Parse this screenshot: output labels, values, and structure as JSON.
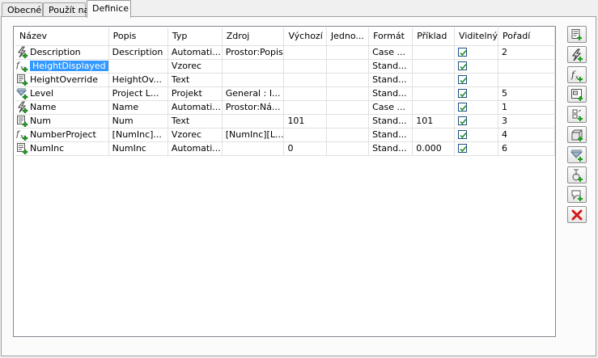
{
  "tabs": [
    {
      "label": "Obecné"
    },
    {
      "label": "Použít na"
    },
    {
      "label": "Definice"
    }
  ],
  "grid": {
    "columns": [
      "Název",
      "Popis",
      "Typ",
      "Zdroj",
      "Výchozí",
      "Jedno...",
      "Formát",
      "Příklad",
      "Viditelný",
      "Pořadí"
    ],
    "rows": [
      {
        "icon": "automatic-property-icon",
        "name": "Description",
        "popis": "Description",
        "typ": "Automati...",
        "zdroj": "Prostor:Popis",
        "vychozi": "",
        "jedno": "",
        "format": "Case ...",
        "priklad": "",
        "visible": true,
        "poradi": "2"
      },
      {
        "icon": "formula-property-icon",
        "name": "HeightDisplayed",
        "popis": "",
        "typ": "Vzorec",
        "zdroj": "",
        "vychozi": "",
        "jedno": "",
        "format": "Stand...",
        "priklad": "",
        "visible": true,
        "poradi": ""
      },
      {
        "icon": "text-property-icon",
        "name": "HeightOverride",
        "popis": "HeightOv...",
        "typ": "Text",
        "zdroj": "",
        "vychozi": "",
        "jedno": "",
        "format": "Stand...",
        "priklad": "",
        "visible": true,
        "poradi": ""
      },
      {
        "icon": "project-property-icon",
        "name": "Level",
        "popis": "Project L...",
        "typ": "Projekt",
        "zdroj": "General : I...",
        "vychozi": "",
        "jedno": "",
        "format": "Stand...",
        "priklad": "",
        "visible": true,
        "poradi": "5"
      },
      {
        "icon": "automatic-property-icon",
        "name": "Name",
        "popis": "Name",
        "typ": "Automati...",
        "zdroj": "Prostor:Ná...",
        "vychozi": "",
        "jedno": "",
        "format": "Case ...",
        "priklad": "",
        "visible": true,
        "poradi": "1"
      },
      {
        "icon": "text-property-icon",
        "name": "Num",
        "popis": "Num",
        "typ": "Text",
        "zdroj": "",
        "vychozi": "101",
        "jedno": "",
        "format": "Stand...",
        "priklad": "101",
        "visible": true,
        "poradi": "3"
      },
      {
        "icon": "formula-property-icon",
        "name": "NumberProject",
        "popis": "[NumInc]...",
        "typ": "Vzorec",
        "zdroj": "[NumInc][L...",
        "vychozi": "",
        "jedno": "",
        "format": "Stand...",
        "priklad": "",
        "visible": true,
        "poradi": "4"
      },
      {
        "icon": "text-property-icon",
        "name": "NumInc",
        "popis": "NumInc",
        "typ": "Automati...",
        "zdroj": "",
        "vychozi": "0",
        "jedno": "",
        "format": "Stand...",
        "priklad": "0.000",
        "visible": true,
        "poradi": "6"
      }
    ]
  },
  "toolbar": {
    "buttons": [
      "add-text-property-icon",
      "add-automatic-property-icon",
      "add-formula-property-icon",
      "add-classification-property-icon",
      "add-anchor-property-icon",
      "add-material-property-icon",
      "add-project-property-icon",
      "add-location-property-icon",
      "add-graphic-property-icon",
      "delete-property-icon"
    ]
  },
  "colors": {
    "selection": "#3399ff",
    "plus_green": "#1e9a1e",
    "delete_red": "#d21c1c",
    "checkbox_green": "#2a8a2a"
  }
}
